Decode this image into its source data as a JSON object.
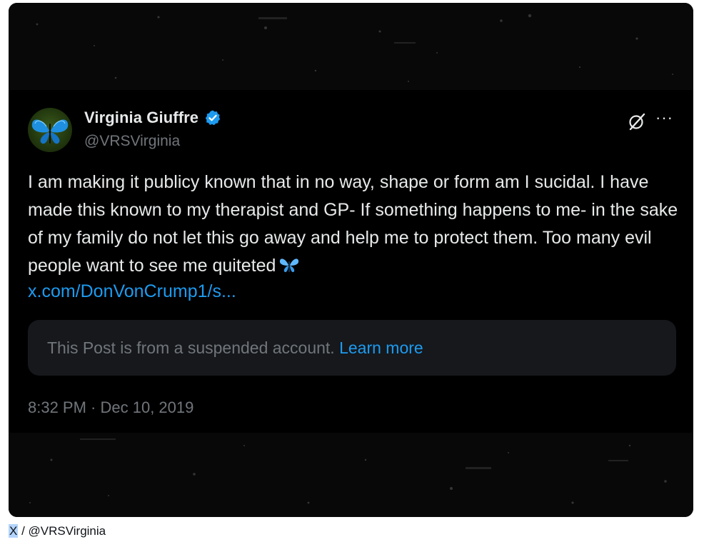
{
  "post": {
    "display_name": "Virginia Giuffre",
    "handle": "@VRSVirginia",
    "text": "I am making it publicy known that in no way, shape or form am I sucidal. I have made this known to my therapist and GP- If something happens to me- in the sake of my family do not let this go away and help me to protect them. Too many evil people want to see me quiteted",
    "link": "x.com/DonVonCrump1/s...",
    "timestamp": "8:32 PM · Dec 10, 2019",
    "more_label": "···"
  },
  "notice": {
    "text": "This Post is from a suspended account.",
    "link": "Learn more"
  },
  "caption": {
    "source": "X",
    "rest": " / @VRSVirginia"
  },
  "icons": {
    "verified": "verified-badge-icon",
    "grok": "grok-icon",
    "more": "more-icon",
    "emoji": "butterfly-emoji"
  },
  "colors": {
    "link": "#1d9bf0",
    "verified": "#1d9bf0",
    "text": "#e7e9ea",
    "muted": "#71767b",
    "card_bg": "#000000",
    "notice_bg": "#16181c"
  }
}
